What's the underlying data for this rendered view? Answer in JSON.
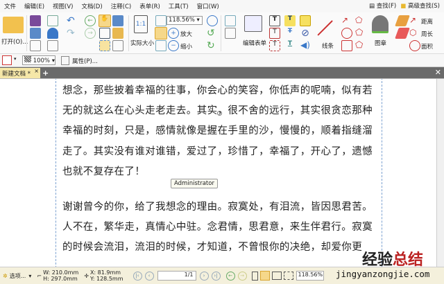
{
  "menu": [
    "文件",
    "编辑(E)",
    "视图(V)",
    "文档(D)",
    "注释(C)",
    "表单(R)",
    "工具(T)",
    "窗口(W)"
  ],
  "search": {
    "find": "查找(F)",
    "advanced_find": "高级查找(S)"
  },
  "ribbon": {
    "open": "打开(O)...",
    "actual_size": "实际大小",
    "zoom_value": "118.56%",
    "zoom_in": "放大",
    "zoom_out": "缩小",
    "edit_form": "编辑表单",
    "lines": "线条",
    "stamp": "图章",
    "distance": "距离",
    "perimeter": "周长",
    "area": "面积"
  },
  "toolbar2": {
    "opacity": "100%",
    "properties": "属性(P)..."
  },
  "tab": {
    "label": "新建文档 *"
  },
  "document": {
    "para1": [
      "想念，那些披着幸福的往事，你会心的笑容，你低声的呢喃，似有若",
      "无的就这么在心头走老走去。其实，很不舍的远行，其实很贪恋那种",
      "幸福的时刻，只是，感情就像是握在手里的沙，慢慢的，顺着指缝溜",
      "走了。其实没有谁对谁错，爱过了，珍惜了，幸福了，开心了，遗憾",
      "也就不复存在了！"
    ],
    "tooltip": "Administrator",
    "para2": [
      "谢谢曾今的你，给了我想念的理由。寂寞处，有泪流，皆因思君苦。",
      "人不在，繁华走，真情心中驻。念君情，思君意，来生伴君行。寂寞",
      "的时候会流泪，流泪的时候，才知道，不曾恨你的决绝，却爱你更"
    ]
  },
  "status": {
    "options": "选项...",
    "width": "W: 210.0mm",
    "height": "H: 297.0mm",
    "x": "X:  81.9mm",
    "y": "Y: 128.5mm",
    "page": "1/1",
    "zoom": "118.56%"
  },
  "watermark": {
    "cn_a": "经验",
    "cn_b": "总结",
    "url": "jingyanzongjie.com"
  }
}
